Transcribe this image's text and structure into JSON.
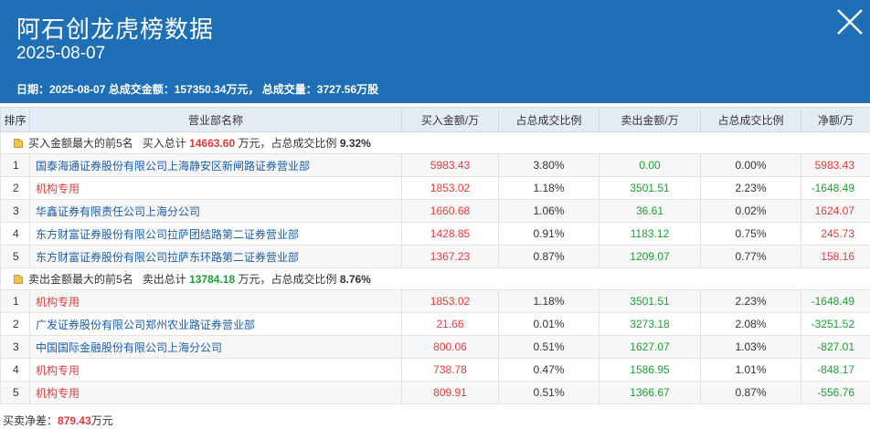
{
  "header": {
    "title": "阿石创龙虎榜数据",
    "date": "2025-08-07",
    "summary": "日期：2025-08-07 总成交金额：157350.34万元， 总成交量：3727.56万股"
  },
  "columns": [
    "排序",
    "营业部名称",
    "买入金额/万",
    "占总成交比例",
    "卖出金额/万",
    "占总成交比例",
    "净额/万"
  ],
  "buy_group": {
    "label": "买入金额最大的前5名",
    "total_prefix": "买入总计",
    "total_value": "14663.60",
    "total_suffix": "万元，占总成交比例",
    "ratio": "9.32%"
  },
  "buy_rows": [
    {
      "rank": "1",
      "name": "国泰海通证券股份有限公司上海静安区新闸路证券营业部",
      "buy": "5983.43",
      "buy_pct": "3.80%",
      "sell": "0.00",
      "sell_pct": "0.00%",
      "net": "5983.43"
    },
    {
      "rank": "2",
      "name": "机构专用",
      "buy": "1853.02",
      "buy_pct": "1.18%",
      "sell": "3501.51",
      "sell_pct": "2.23%",
      "net": "-1648.49"
    },
    {
      "rank": "3",
      "name": "华鑫证券有限责任公司上海分公司",
      "buy": "1660.68",
      "buy_pct": "1.06%",
      "sell": "36.61",
      "sell_pct": "0.02%",
      "net": "1624.07"
    },
    {
      "rank": "4",
      "name": "东方财富证券股份有限公司拉萨团结路第二证券营业部",
      "buy": "1428.85",
      "buy_pct": "0.91%",
      "sell": "1183.12",
      "sell_pct": "0.75%",
      "net": "245.73"
    },
    {
      "rank": "5",
      "name": "东方财富证券股份有限公司拉萨东环路第二证券营业部",
      "buy": "1367.23",
      "buy_pct": "0.87%",
      "sell": "1209.07",
      "sell_pct": "0.77%",
      "net": "158.16"
    }
  ],
  "sell_group": {
    "label": "卖出金额最大的前5名",
    "total_prefix": "卖出总计",
    "total_value": "13784.18",
    "total_suffix": "万元，占总成交比例",
    "ratio": "8.76%"
  },
  "sell_rows": [
    {
      "rank": "1",
      "name": "机构专用",
      "buy": "1853.02",
      "buy_pct": "1.18%",
      "sell": "3501.51",
      "sell_pct": "2.23%",
      "net": "-1648.49"
    },
    {
      "rank": "2",
      "name": "广发证券股份有限公司郑州农业路证券营业部",
      "buy": "21.66",
      "buy_pct": "0.01%",
      "sell": "3273.18",
      "sell_pct": "2.08%",
      "net": "-3251.52"
    },
    {
      "rank": "3",
      "name": "中国国际金融股份有限公司上海分公司",
      "buy": "800.06",
      "buy_pct": "0.51%",
      "sell": "1627.07",
      "sell_pct": "1.03%",
      "net": "-827.01"
    },
    {
      "rank": "4",
      "name": "机构专用",
      "buy": "738.78",
      "buy_pct": "0.47%",
      "sell": "1586.95",
      "sell_pct": "1.01%",
      "net": "-848.17"
    },
    {
      "rank": "5",
      "name": "机构专用",
      "buy": "809.91",
      "buy_pct": "0.51%",
      "sell": "1366.67",
      "sell_pct": "0.87%",
      "net": "-556.76"
    }
  ],
  "footer": {
    "label": "买卖净差：",
    "value": "879.43",
    "unit": "万元"
  },
  "colors": {
    "header_bg": "#1e6fb5",
    "up": "#e4393c",
    "down": "#1aa034",
    "link": "#1a5ea8"
  },
  "icons": {
    "close": "close-icon",
    "group": "folder-icon"
  }
}
